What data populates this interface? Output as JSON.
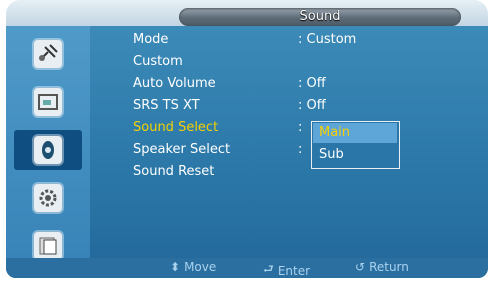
{
  "title": "Sound",
  "sidebar": {
    "items": [
      {
        "name": "picture",
        "icon": "satellite-icon",
        "selected": false
      },
      {
        "name": "input",
        "icon": "display-icon",
        "selected": false
      },
      {
        "name": "sound",
        "icon": "sound-icon",
        "selected": true
      },
      {
        "name": "setup",
        "icon": "gear-icon",
        "selected": false
      },
      {
        "name": "multi",
        "icon": "multi-control-icon",
        "selected": false
      }
    ]
  },
  "menu": [
    {
      "label": "Mode",
      "value": ": Custom"
    },
    {
      "label": "Custom",
      "value": ""
    },
    {
      "label": "Auto Volume",
      "value": ": Off"
    },
    {
      "label": "SRS TS XT",
      "value": ": Off"
    },
    {
      "label": "Sound Select",
      "value": ":"
    },
    {
      "label": "Speaker Select",
      "value": ":"
    },
    {
      "label": "Sound Reset",
      "value": ""
    }
  ],
  "dropdown": {
    "options": [
      "Main",
      "Sub"
    ],
    "selected": "Main"
  },
  "footer": {
    "move": "Move",
    "enter": "Enter",
    "return": "Return"
  },
  "colors": {
    "accent": "#f4d000",
    "panel": "#2a77a7"
  }
}
